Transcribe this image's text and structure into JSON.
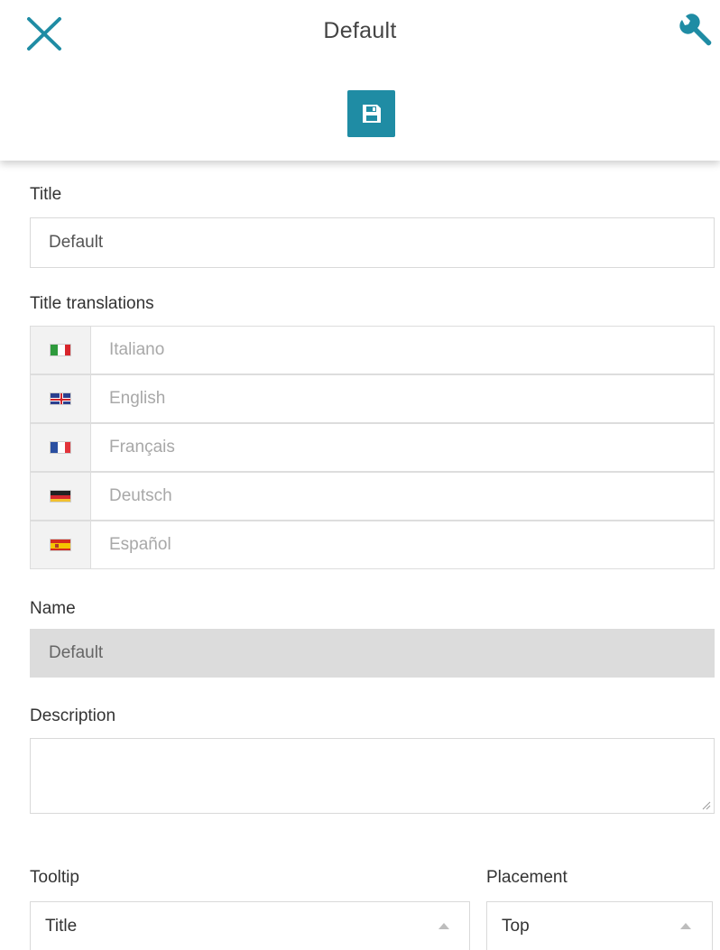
{
  "header": {
    "title": "Default",
    "close_icon": "close-icon",
    "settings_icon": "wrench-icon",
    "save_icon": "floppy-disk-icon",
    "accent_color": "#1f8ca4"
  },
  "form": {
    "title_label": "Title",
    "title_value": "Default",
    "translations_label": "Title translations",
    "translations": [
      {
        "flag": "flag-it-icon",
        "placeholder": "Italiano"
      },
      {
        "flag": "flag-uk-icon",
        "placeholder": "English"
      },
      {
        "flag": "flag-fr-icon",
        "placeholder": "Français"
      },
      {
        "flag": "flag-de-icon",
        "placeholder": "Deutsch"
      },
      {
        "flag": "flag-es-icon",
        "placeholder": "Español"
      }
    ],
    "name_label": "Name",
    "name_value": "Default",
    "description_label": "Description",
    "description_value": "",
    "tooltip_label": "Tooltip",
    "tooltip_value": "Title",
    "placement_label": "Placement",
    "placement_value": "Top"
  }
}
